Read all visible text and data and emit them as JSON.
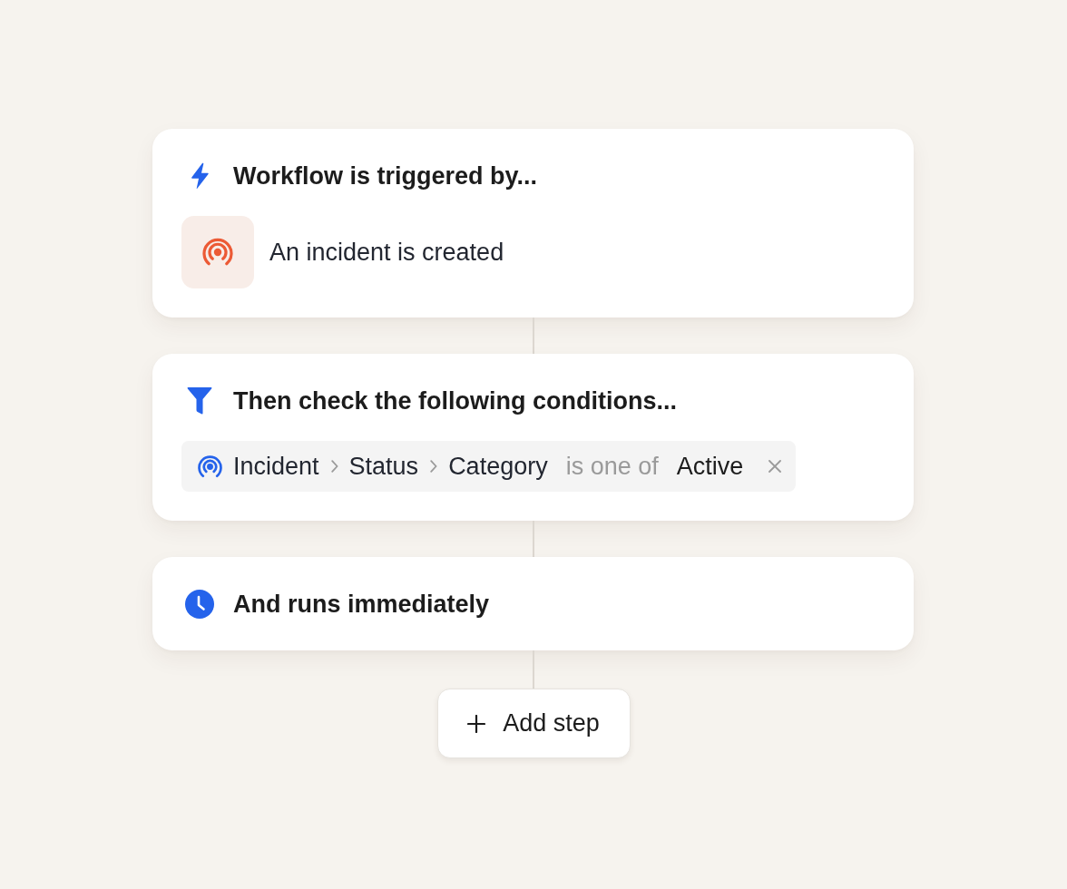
{
  "steps": [
    {
      "kind": "trigger",
      "title": "Workflow is triggered by...",
      "trigger": {
        "label": "An incident is created"
      }
    },
    {
      "kind": "conditions",
      "title": "Then check the following conditions...",
      "conditions": [
        {
          "path": [
            "Incident",
            "Status",
            "Category"
          ],
          "operator": "is one of",
          "value": "Active"
        }
      ]
    },
    {
      "kind": "timing",
      "title": "And runs immediately"
    }
  ],
  "add_step": {
    "label": "Add step"
  }
}
